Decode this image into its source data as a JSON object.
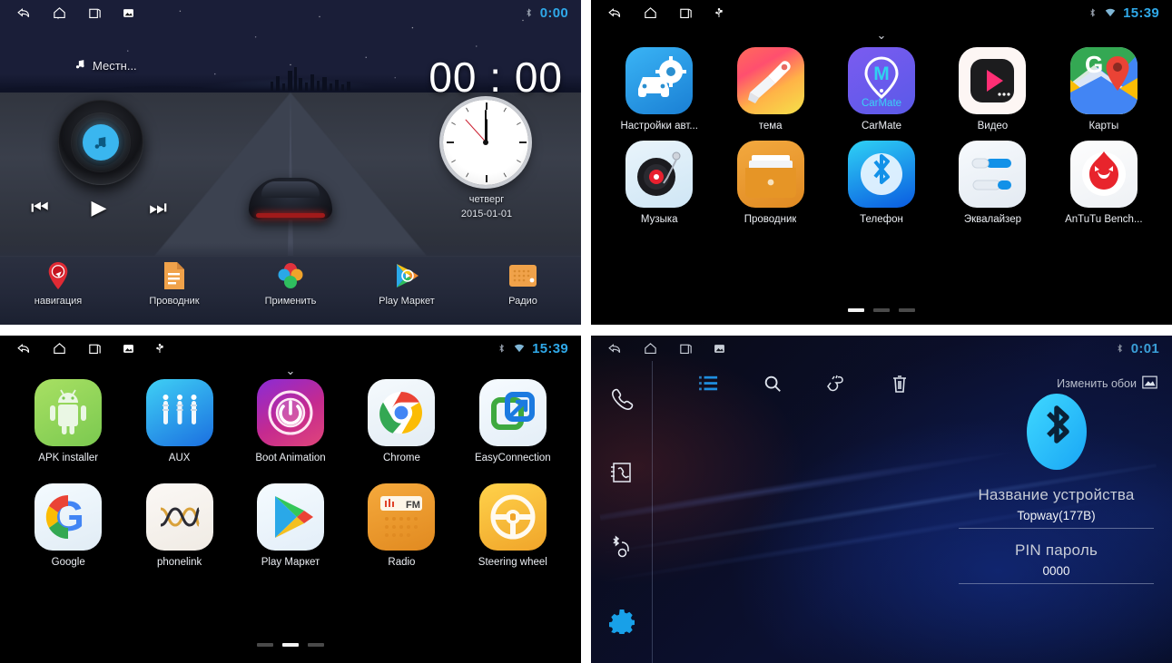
{
  "panels": {
    "home": {
      "name": "car-launcher-home",
      "statusbar": {
        "icons": [
          "back-icon",
          "home-icon",
          "recents-icon",
          "screenshot-icon"
        ],
        "bluetooth": "bluetooth-icon",
        "time": "0:00"
      },
      "music_widget": {
        "source_label": "Местн...",
        "note_icon": "music-note-icon",
        "prev": "skip-previous-icon",
        "play": "play-icon",
        "next": "skip-next-icon"
      },
      "clock_widget": {
        "digital_time": "00 : 00",
        "weekday": "четверг",
        "date": "2015-01-01"
      },
      "dock": [
        {
          "label": "навигация",
          "icon": "navigation-pin-icon"
        },
        {
          "label": "Проводник",
          "icon": "file-manager-icon"
        },
        {
          "label": "Применить",
          "icon": "apply-petals-icon"
        },
        {
          "label": "Play Маркет",
          "icon": "play-store-icon"
        },
        {
          "label": "Радио",
          "icon": "radio-icon"
        }
      ]
    },
    "apps_page1": {
      "name": "app-drawer-page-1",
      "statusbar": {
        "icons": [
          "back-icon",
          "home-icon",
          "recents-icon",
          "usb-icon"
        ],
        "bluetooth": "bluetooth-icon",
        "wifi": "wifi-icon",
        "time": "15:39"
      },
      "pull_handle": "chevron-down-icon",
      "rows": [
        [
          {
            "label": "Настройки авт...",
            "icon": "car-settings-icon"
          },
          {
            "label": "тема",
            "icon": "theme-brush-icon"
          },
          {
            "label": "CarMate",
            "icon": "carmate-icon"
          },
          {
            "label": "Видео",
            "icon": "video-player-icon"
          },
          {
            "label": "Карты",
            "icon": "google-maps-icon"
          }
        ],
        [
          {
            "label": "Музыка",
            "icon": "music-turntable-icon"
          },
          {
            "label": "Проводник",
            "icon": "file-folder-icon"
          },
          {
            "label": "Телефон",
            "icon": "bluetooth-phone-icon"
          },
          {
            "label": "Эквалайзер",
            "icon": "equalizer-icon"
          },
          {
            "label": "AnTuTu Bench...",
            "icon": "antutu-icon"
          }
        ]
      ],
      "pages": 3,
      "active_page": 1
    },
    "apps_page2": {
      "name": "app-drawer-page-2",
      "statusbar": {
        "icons": [
          "back-icon",
          "home-icon",
          "recents-icon",
          "screenshot-icon",
          "usb-icon"
        ],
        "bluetooth": "bluetooth-icon",
        "wifi": "wifi-icon",
        "time": "15:39"
      },
      "pull_handle": "chevron-down-icon",
      "rows": [
        [
          {
            "label": "APK installer",
            "icon": "android-icon"
          },
          {
            "label": "AUX",
            "icon": "aux-jack-icon"
          },
          {
            "label": "Boot Animation",
            "icon": "power-boot-icon"
          },
          {
            "label": "Chrome",
            "icon": "chrome-icon"
          },
          {
            "label": "EasyConnection",
            "icon": "easyconnection-icon"
          }
        ],
        [
          {
            "label": "Google",
            "icon": "google-icon"
          },
          {
            "label": "phonelink",
            "icon": "phonelink-icon"
          },
          {
            "label": "Play Маркет",
            "icon": "play-store-icon"
          },
          {
            "label": "Radio",
            "icon": "radio-fm-icon"
          },
          {
            "label": "Steering wheel",
            "icon": "steering-wheel-icon"
          }
        ]
      ],
      "pages": 3,
      "active_page": 2
    },
    "bluetooth": {
      "name": "bluetooth-settings",
      "statusbar": {
        "icons": [
          "back-icon",
          "home-icon",
          "recents-icon",
          "screenshot-icon"
        ],
        "bluetooth": "bluetooth-icon",
        "time": "0:01"
      },
      "toolbar": {
        "buttons": [
          {
            "name": "list-icon",
            "active": true
          },
          {
            "name": "search-icon",
            "active": false
          },
          {
            "name": "gesture-hand-icon",
            "active": false
          },
          {
            "name": "trash-icon",
            "active": false
          }
        ],
        "wallpaper_label": "Изменить обои",
        "wallpaper_icon": "image-icon"
      },
      "sidebar": [
        {
          "name": "dialpad-phone-icon",
          "selected": false
        },
        {
          "name": "contacts-icon",
          "selected": false
        },
        {
          "name": "bluetooth-headset-icon",
          "selected": false
        },
        {
          "name": "settings-gear-icon",
          "selected": true
        }
      ],
      "logo_icon": "bluetooth-logo-icon",
      "fields": [
        {
          "label": "Название устройства",
          "value": "Topway(177B)"
        },
        {
          "label": "PIN пароль",
          "value": "0000"
        }
      ]
    }
  },
  "colors": {
    "accent_blue": "#2fa8e8",
    "gear_blue": "#18a0e8",
    "toolbar_active": "#1f8fe0"
  }
}
